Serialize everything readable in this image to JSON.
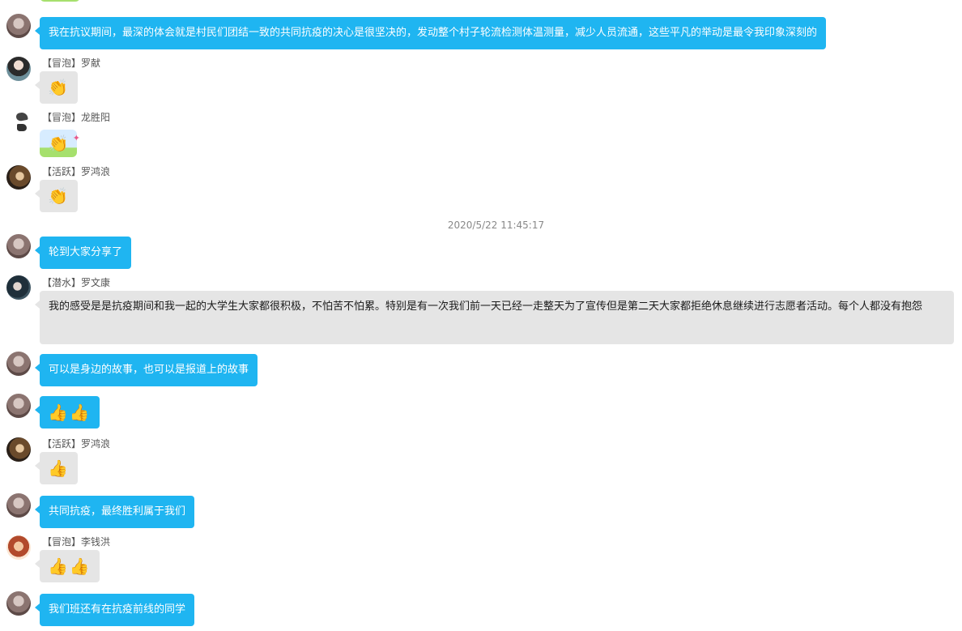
{
  "timestamp": "2020/5/22 11:45:17",
  "messages": [
    {
      "sender": "",
      "text": "我在抗议期间，最深的体会就是村民们团结一致的共同抗疫的决心是很坚决的，发动整个村子轮流检测体温测量，减少人员流通，这些平凡的举动是最令我印象深刻的"
    },
    {
      "sender": "【冒泡】罗献",
      "text": "👏"
    },
    {
      "sender": "【冒泡】龙胜阳",
      "text": "👏"
    },
    {
      "sender": "【活跃】罗鸿浪",
      "text": "👏"
    },
    {
      "sender": "",
      "text": "轮到大家分享了"
    },
    {
      "sender": "【潜水】罗文康",
      "text": "我的感受是是抗疫期间和我一起的大学生大家都很积极，不怕苦不怕累。特别是有一次我们前一天已经一走整天为了宣传但是第二天大家都拒绝休息继续进行志愿者活动。每个人都没有抱怨"
    },
    {
      "sender": "",
      "text": "可以是身边的故事，也可以是报道上的故事"
    },
    {
      "sender": "",
      "text": "👍👍"
    },
    {
      "sender": "【活跃】罗鸿浪",
      "text": "👍"
    },
    {
      "sender": "",
      "text": "共同抗疫，最终胜利属于我们"
    },
    {
      "sender": "【冒泡】李钱洪",
      "text": "👍👍"
    },
    {
      "sender": "",
      "text": "我们班还有在抗疫前线的同学"
    }
  ]
}
